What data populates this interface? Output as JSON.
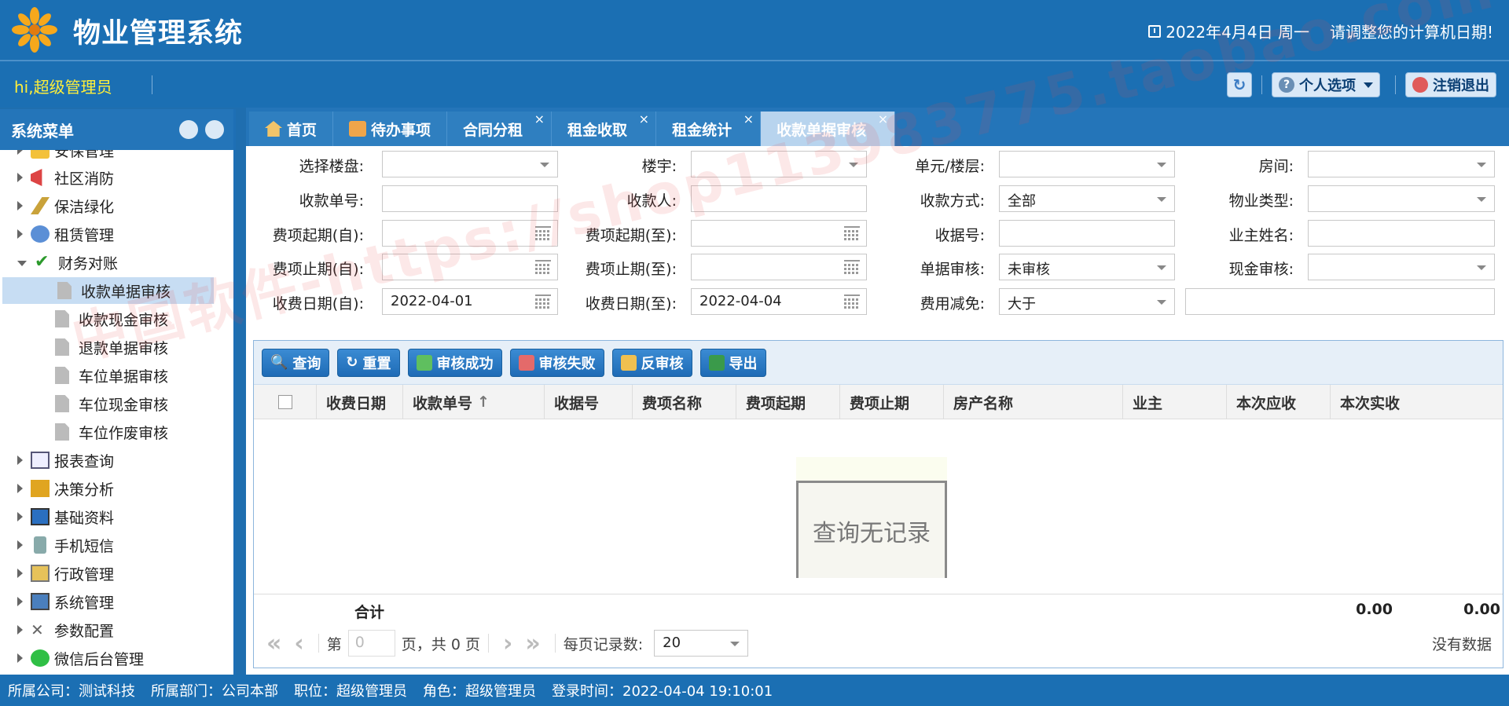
{
  "header": {
    "title": "物业管理系统",
    "date": "2022年4月4日 周一",
    "date_note": "请调整您的计算机日期!"
  },
  "userbar": {
    "greeting": "hi,超级管理员",
    "personal_options": "个人选项",
    "logout": "注销退出"
  },
  "sidebar": {
    "title": "系统菜单",
    "items": [
      {
        "label": "安保管理",
        "icon": "shield-icon"
      },
      {
        "label": "社区消防",
        "icon": "megaphone-icon"
      },
      {
        "label": "保洁绿化",
        "icon": "broom-icon"
      },
      {
        "label": "租赁管理",
        "icon": "people-icon"
      },
      {
        "label": "财务对账",
        "icon": "check-icon"
      },
      {
        "label": "收款单据审核"
      },
      {
        "label": "收款现金审核"
      },
      {
        "label": "退款单据审核"
      },
      {
        "label": "车位单据审核"
      },
      {
        "label": "车位现金审核"
      },
      {
        "label": "车位作废审核"
      },
      {
        "label": "报表查询",
        "icon": "chart-icon"
      },
      {
        "label": "决策分析",
        "icon": "cube-icon"
      },
      {
        "label": "基础资料",
        "icon": "computer-icon"
      },
      {
        "label": "手机短信",
        "icon": "phone-icon"
      },
      {
        "label": "行政管理",
        "icon": "clipboard-icon"
      },
      {
        "label": "系统管理",
        "icon": "monitor-icon"
      },
      {
        "label": "参数配置",
        "icon": "tools-icon"
      },
      {
        "label": "微信后台管理",
        "icon": "wechat-icon"
      }
    ]
  },
  "tabs": [
    {
      "label": "首页",
      "closable": false
    },
    {
      "label": "待办事项",
      "closable": false
    },
    {
      "label": "合同分租",
      "closable": true
    },
    {
      "label": "租金收取",
      "closable": true
    },
    {
      "label": "租金统计",
      "closable": true
    },
    {
      "label": "收款单据审核",
      "closable": true,
      "active": true
    }
  ],
  "form": {
    "building_label": "选择楼盘:",
    "tower_label": "楼宇:",
    "unit_label": "单元/楼层:",
    "room_label": "房间:",
    "receipt_no_label": "收款单号:",
    "payee_label": "收款人:",
    "pay_method_label": "收款方式:",
    "pay_method_value": "全部",
    "property_type_label": "物业类型:",
    "fee_start_from_label": "费项起期(自):",
    "fee_start_to_label": "费项起期(至):",
    "voucher_no_label": "收据号:",
    "owner_name_label": "业主姓名:",
    "fee_end_from_label": "费项止期(自):",
    "fee_end_to_label": "费项止期(至):",
    "doc_audit_label": "单据审核:",
    "doc_audit_value": "未审核",
    "cash_audit_label": "现金审核:",
    "pay_date_from_label": "收费日期(自):",
    "pay_date_from_value": "2022-04-01",
    "pay_date_to_label": "收费日期(至):",
    "pay_date_to_value": "2022-04-04",
    "fee_reduce_label": "费用减免:",
    "fee_reduce_value": "大于"
  },
  "toolbar": {
    "query": "查询",
    "reset": "重置",
    "audit_ok": "审核成功",
    "audit_fail": "审核失败",
    "audit_revert": "反审核",
    "export": "导出"
  },
  "table": {
    "columns": [
      "收费日期",
      "收款单号",
      "收据号",
      "费项名称",
      "费项起期",
      "费项止期",
      "房产名称",
      "业主",
      "本次应收",
      "本次实收"
    ],
    "empty_text": "查询无记录",
    "sum_label": "合计",
    "sum_receivable": "0.00",
    "sum_received": "0.00"
  },
  "pager": {
    "page_prefix": "第",
    "page_value": "0",
    "page_suffix": "页，共 0 页",
    "per_page_label": "每页记录数:",
    "per_page_value": "20",
    "no_data": "没有数据"
  },
  "watermark": "中国软件-https://shop113983775.taobao.com",
  "status": {
    "company": "所属公司：测试科技",
    "department": "所属部门：公司本部",
    "position": "职位：超级管理员",
    "role": "角色：超级管理员",
    "login_time": "登录时间：2022-04-04 19:10:01"
  }
}
